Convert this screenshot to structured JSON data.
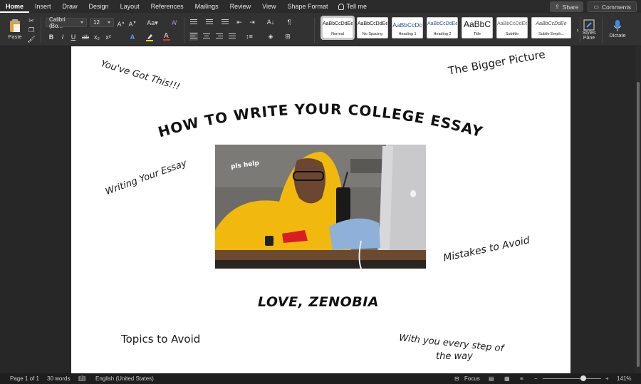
{
  "tabs": [
    {
      "label": "Home",
      "active": true
    },
    {
      "label": "Insert"
    },
    {
      "label": "Draw"
    },
    {
      "label": "Design"
    },
    {
      "label": "Layout"
    },
    {
      "label": "References"
    },
    {
      "label": "Mailings"
    },
    {
      "label": "Review"
    },
    {
      "label": "View"
    },
    {
      "label": "Shape Format"
    }
  ],
  "tell_me": "Tell me",
  "share_label": "Share",
  "comments_label": "Comments",
  "ribbon": {
    "paste_label": "Paste",
    "font_name": "Calibri (Bo...",
    "font_size": "12",
    "styles": [
      {
        "preview": "AaBbCcDdEe",
        "name": "Normal",
        "selected": true
      },
      {
        "preview": "AaBbCcDdEe",
        "name": "No Spacing"
      },
      {
        "preview": "AaBbCcDc",
        "name": "Heading 1"
      },
      {
        "preview": "AaBbCcDdEe",
        "name": "Heading 2"
      },
      {
        "preview": "AaBbC",
        "name": "Title"
      },
      {
        "preview": "AaBbCcDdEe",
        "name": "Subtitle"
      },
      {
        "preview": "AaBbCcDdEe",
        "name": "Subtle Emph..."
      }
    ],
    "styles_pane_label_1": "Styles",
    "styles_pane_label_2": "Pane",
    "dictate_label": "Dictate"
  },
  "document": {
    "notes": {
      "got_this": "You've Got This!!!",
      "bigger_picture": "The Bigger Picture",
      "writing_essay": "Writing Your Essay",
      "mistakes": "Mistakes to Avoid",
      "topics": "Topics to Avoid",
      "every_step_1": "With you every step of",
      "every_step_2": "the way"
    },
    "title": "HOW TO WRITE YOUR COLLEGE ESSAY",
    "photo_caption": "pls help",
    "signoff": "LOVE, ZENOBIA"
  },
  "status": {
    "page": "Page 1 of 1",
    "words": "30 words",
    "language": "English (United States)",
    "focus": "Focus",
    "zoom": "141%",
    "zoom_level": 0.7
  }
}
